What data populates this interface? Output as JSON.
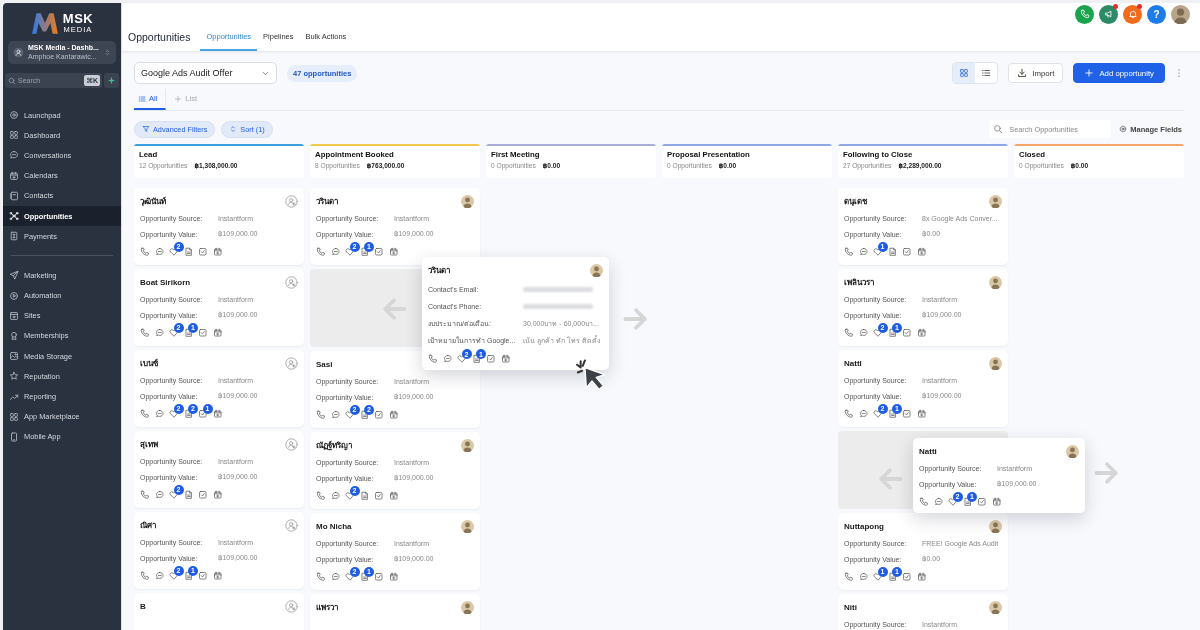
{
  "sidebar": {
    "logo": {
      "word": "MSK",
      "sub": "MEDIA"
    },
    "account": {
      "name": "MSK Media - Dashb...",
      "location": "Amphoe Kantarawic..."
    },
    "search": {
      "placeholder": "Search",
      "shortcut": "⌘K"
    },
    "sections": [
      {
        "items": [
          {
            "label": "Launchpad",
            "selected": false
          },
          {
            "label": "Dashboard",
            "selected": false
          },
          {
            "label": "Conversations",
            "selected": false
          },
          {
            "label": "Calendars",
            "selected": false
          },
          {
            "label": "Contacts",
            "selected": false
          },
          {
            "label": "Opportunities",
            "selected": true
          },
          {
            "label": "Payments",
            "selected": false
          }
        ]
      },
      {
        "items": [
          {
            "label": "Marketing",
            "selected": false
          },
          {
            "label": "Automation",
            "selected": false
          },
          {
            "label": "Sites",
            "selected": false
          },
          {
            "label": "Memberships",
            "selected": false
          },
          {
            "label": "Media Storage",
            "selected": false
          },
          {
            "label": "Reputation",
            "selected": false
          },
          {
            "label": "Reporting",
            "selected": false
          },
          {
            "label": "App Marketplace",
            "selected": false
          },
          {
            "label": "Mobile App",
            "selected": false
          }
        ]
      }
    ]
  },
  "header": {
    "icons": [
      {
        "kind": "phone"
      },
      {
        "kind": "megaphone",
        "dot": true
      },
      {
        "kind": "bell",
        "dot": true
      },
      {
        "kind": "help",
        "text": "?"
      },
      {
        "kind": "avatar"
      }
    ],
    "title": "Opportunities",
    "tabs": [
      {
        "label": "Opportunities",
        "selected": true
      },
      {
        "label": "Pipelines",
        "selected": false
      },
      {
        "label": "Bulk Actions",
        "selected": false
      }
    ]
  },
  "toolbar": {
    "pipeline": "Google Ads Audit Offer",
    "count": "47 opportunities",
    "views": [
      {
        "kind": "grid",
        "selected": true
      },
      {
        "kind": "list",
        "selected": false
      }
    ],
    "import": "Import",
    "add": "Add opportunity"
  },
  "lists": [
    {
      "kind": "view",
      "label": "All",
      "selected": true
    },
    {
      "kind": "add",
      "label": "List",
      "selected": false
    }
  ],
  "filters": {
    "advanced": "Advanced Filters",
    "sort": "Sort (1)",
    "search_placeholder": "Search Opportunities",
    "manage": "Manage Fields"
  },
  "stages": [
    {
      "name": "Lead",
      "count": "12 Opportunities",
      "total": "฿1,308,000.00",
      "color": "#3b9fe0",
      "cards": [
        {
          "kind": "card",
          "name": "วุฒินันท์",
          "assigned": false,
          "fields": [
            {
              "label": "Opportunity Source:",
              "value": "Instantform"
            },
            {
              "label": "Opportunity Value:",
              "value": "฿109,000.00"
            }
          ],
          "counts": {
            "tag": "2"
          }
        },
        {
          "kind": "card",
          "name": "Boat Sirikorn",
          "assigned": false,
          "fields": [
            {
              "label": "Opportunity Source:",
              "value": "Instantform"
            },
            {
              "label": "Opportunity Value:",
              "value": "฿109,000.00"
            }
          ],
          "counts": {
            "tag": "2",
            "note": "1"
          }
        },
        {
          "kind": "card",
          "name": "เบนซ์",
          "assigned": false,
          "fields": [
            {
              "label": "Opportunity Source:",
              "value": "Instantform"
            },
            {
              "label": "Opportunity Value:",
              "value": "฿109,000.00"
            }
          ],
          "counts": {
            "tag": "2",
            "note": "2",
            "task": "1"
          }
        },
        {
          "kind": "card",
          "name": "สุเทพ",
          "assigned": false,
          "fields": [
            {
              "label": "Opportunity Source:",
              "value": "Instantform"
            },
            {
              "label": "Opportunity Value:",
              "value": "฿109,000.00"
            }
          ],
          "counts": {
            "tag": "2"
          }
        },
        {
          "kind": "card",
          "name": "ณิศา",
          "assigned": false,
          "fields": [
            {
              "label": "Opportunity Source:",
              "value": "Instantform"
            },
            {
              "label": "Opportunity Value:",
              "value": "฿109,000.00"
            }
          ],
          "counts": {
            "tag": "2",
            "note": "1"
          }
        },
        {
          "kind": "card",
          "name": "B",
          "assigned": false
        }
      ]
    },
    {
      "name": "Appointment Booked",
      "count": "8 Opportunities",
      "total": "฿763,000.00",
      "color": "#f2c94c",
      "cards": [
        {
          "kind": "card",
          "name": "วรินดา",
          "assigned": true,
          "fields": [
            {
              "label": "Opportunity Source:",
              "value": "Instantform"
            },
            {
              "label": "Opportunity Value:",
              "value": "฿109,000.00"
            }
          ],
          "counts": {
            "tag": "2",
            "note": "1"
          }
        },
        {
          "kind": "placeholder",
          "dragged": {
            "name": "วรินดา",
            "assigned": true,
            "cursor": true,
            "fields": [
              {
                "label": "Contact's Email:",
                "blurred": true
              },
              {
                "label": "Contact's Phone:",
                "blurred": true
              },
              {
                "label": "งบประมาณ/ต่อเดือน:",
                "value": "30,000บาท - 60,000บา..."
              },
              {
                "label": "เป้าหมายในการทำ Google...",
                "value": "เน้น ลูกค้า ทัก โทร ติดตั้ง"
              }
            ],
            "counts": {
              "tag": "2",
              "note": "1"
            }
          }
        },
        {
          "kind": "card",
          "name": "Sasi",
          "fields": [
            {
              "label": "Opportunity Source:",
              "value": "Instantform"
            },
            {
              "label": "Opportunity Value:",
              "value": "฿109,000.00"
            }
          ],
          "counts": {
            "tag": "2",
            "note": "2"
          }
        },
        {
          "kind": "card",
          "name": "ณัฏฐ์ทริญา",
          "assigned": true,
          "fields": [
            {
              "label": "Opportunity Source:",
              "value": "Instantform"
            },
            {
              "label": "Opportunity Value:",
              "value": "฿109,000.00"
            }
          ],
          "counts": {
            "tag": "2"
          }
        },
        {
          "kind": "card",
          "name": "Mo Nicha",
          "assigned": true,
          "fields": [
            {
              "label": "Opportunity Source:",
              "value": "Instantform"
            },
            {
              "label": "Opportunity Value:",
              "value": "฿109,000.00"
            }
          ],
          "counts": {
            "tag": "2",
            "note": "1"
          }
        },
        {
          "kind": "card",
          "name": "แพรวา",
          "assigned": true
        }
      ]
    },
    {
      "name": "First Meeting",
      "count": "0 Opportunities",
      "total": "฿0.00",
      "color": "#a9acd6"
    },
    {
      "name": "Proposal Presentation",
      "count": "0 Opportunities",
      "total": "฿0.00",
      "color": "#8fa7e6"
    },
    {
      "name": "Following to Close",
      "count": "27 Opportunities",
      "total": "฿2,289,000.00",
      "color": "#8fa7e6",
      "cards": [
        {
          "kind": "card",
          "name": "ดนุเดช",
          "assigned": true,
          "fields": [
            {
              "label": "Opportunity Source:",
              "value": "8x Google Ads Conver..."
            },
            {
              "label": "Opportunity Value:",
              "value": "฿0.00"
            }
          ],
          "counts": {
            "tag": "1"
          }
        },
        {
          "kind": "card",
          "name": "เพลินวรา",
          "assigned": true,
          "fields": [
            {
              "label": "Opportunity Source:",
              "value": "Instantform"
            },
            {
              "label": "Opportunity Value:",
              "value": "฿109,000.00"
            }
          ],
          "counts": {
            "tag": "2",
            "note": "1"
          }
        },
        {
          "kind": "card",
          "name": "Natti",
          "assigned": true,
          "fields": [
            {
              "label": "Opportunity Source:",
              "value": "Instantform"
            },
            {
              "label": "Opportunity Value:",
              "value": "฿109,000.00"
            }
          ],
          "counts": {
            "tag": "2",
            "note": "1"
          }
        },
        {
          "kind": "placeholder",
          "dragged": {
            "name": "Natti",
            "assigned": true,
            "fields": [
              {
                "label": "Opportunity Source:",
                "value": "Instantform"
              },
              {
                "label": "Opportunity Value:",
                "value": "฿109,000.00"
              }
            ],
            "counts": {
              "tag": "2",
              "note": "1"
            }
          }
        },
        {
          "kind": "card",
          "name": "Nuttapong",
          "assigned": true,
          "fields": [
            {
              "label": "Opportunity Source:",
              "value": "FREE! Google Ads Audit"
            },
            {
              "label": "Opportunity Value:",
              "value": "฿0.00"
            }
          ],
          "counts": {
            "tag": "1",
            "note": "1"
          }
        },
        {
          "kind": "card",
          "name": "Niti",
          "assigned": true,
          "fields": [
            {
              "label": "Opportunity Source:",
              "value": "Instantform"
            }
          ]
        }
      ]
    },
    {
      "name": "Closed",
      "count": "0 Opportunities",
      "total": "฿0.00",
      "color": "#f4a66a"
    }
  ]
}
